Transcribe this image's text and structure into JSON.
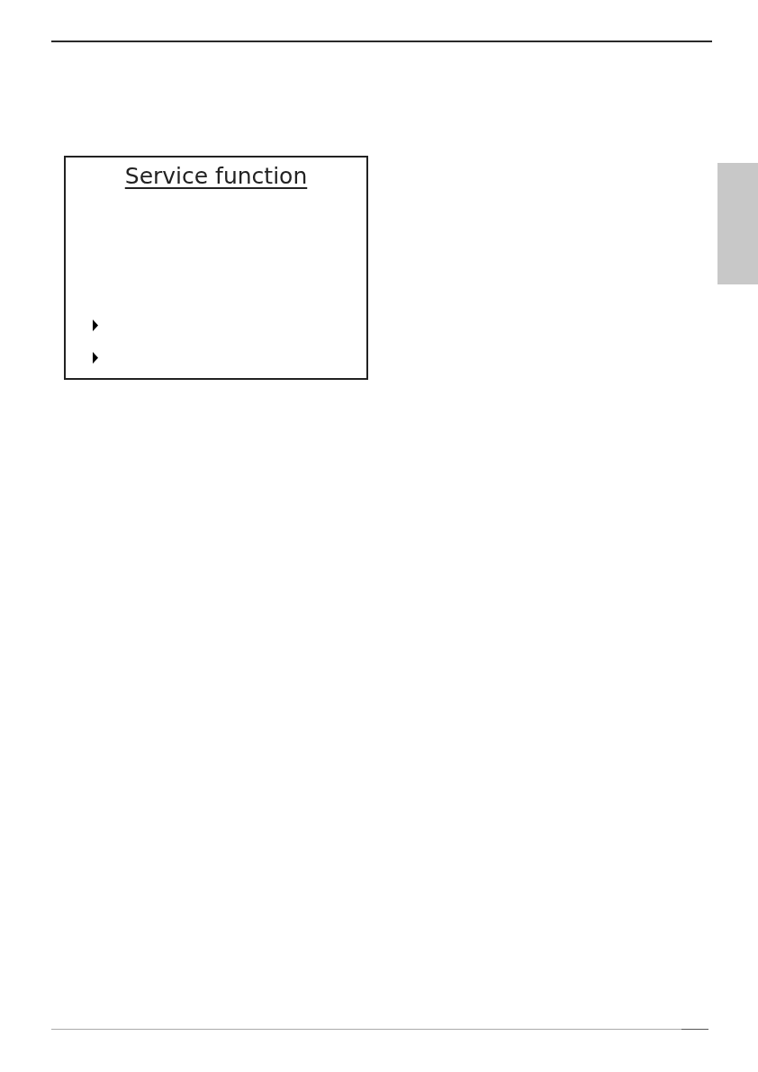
{
  "display": {
    "title": "Service function",
    "menu_markers": [
      {
        "kind": "triangle"
      },
      {
        "kind": "triangle"
      }
    ]
  }
}
